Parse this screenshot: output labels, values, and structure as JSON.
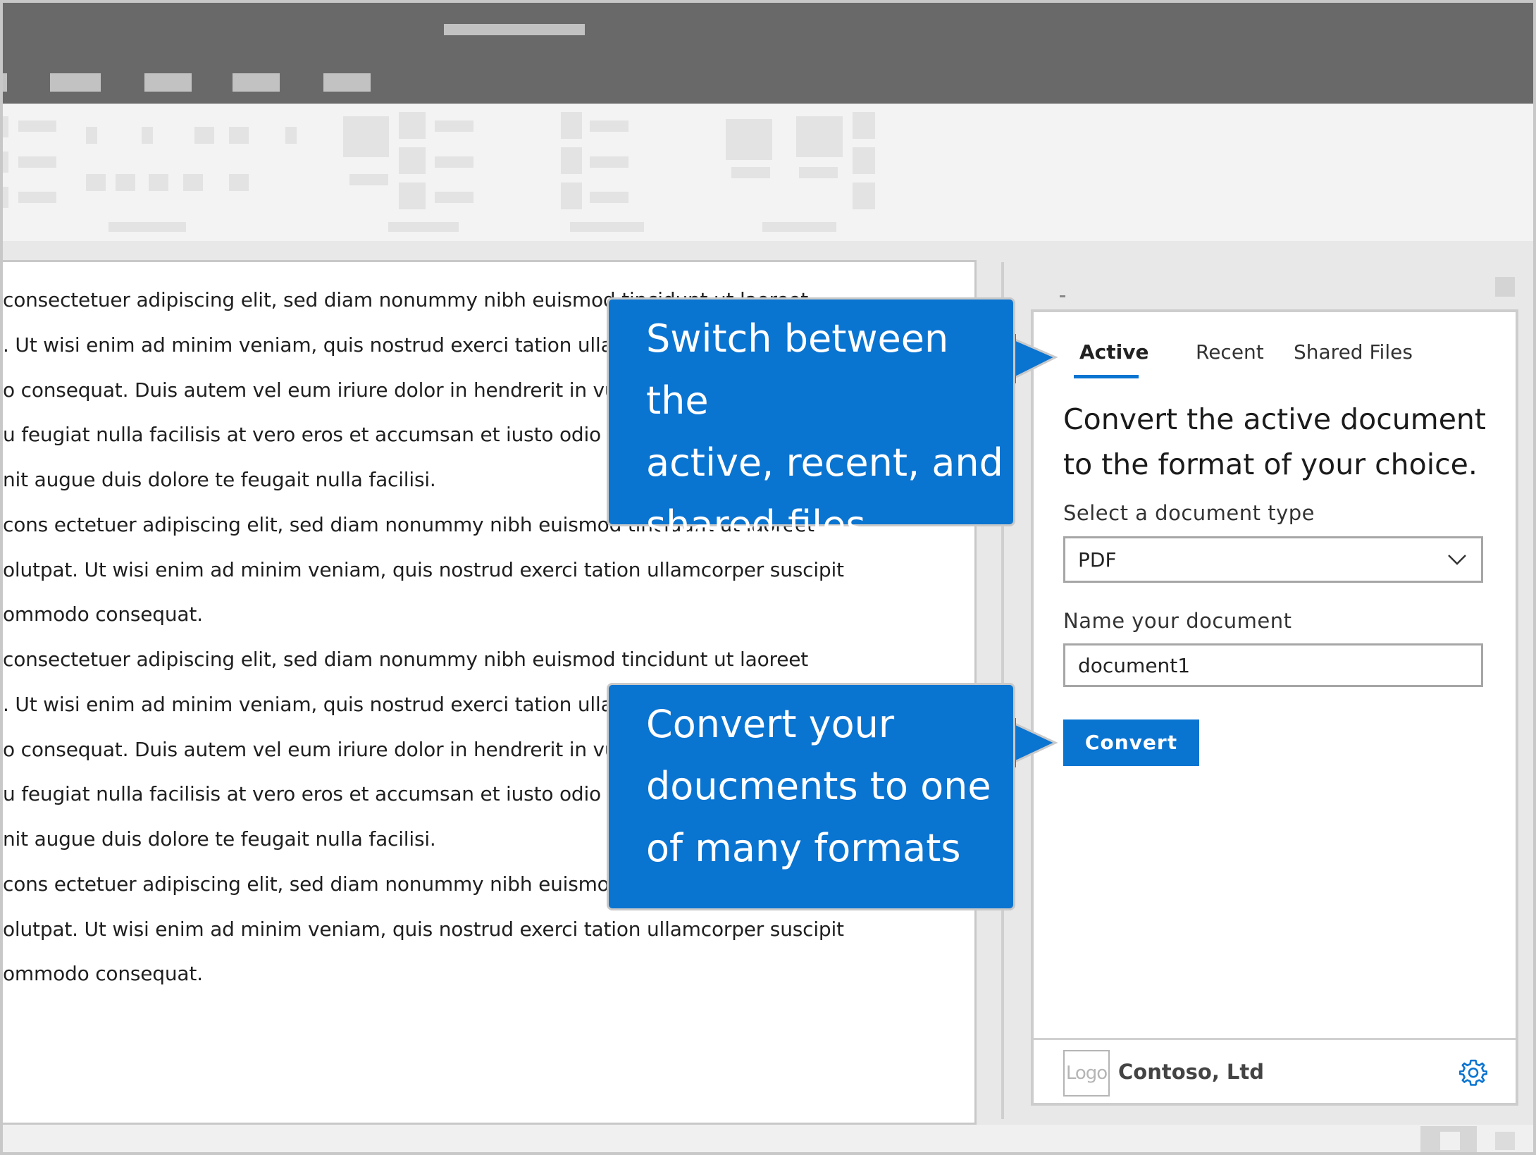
{
  "document": {
    "lines": [
      "consectetuer adipiscing elit, sed diam nonummy nibh euismod tincidunt ut laoreet",
      ". Ut wisi enim ad minim veniam, quis nostrud exerci tation ullamcorper suscipit",
      "o consequat. Duis autem vel eum iriure dolor in hendrerit in vulputate velit esse",
      "u feugiat nulla facilisis at vero eros et accumsan et iusto odio dignissim qui blandit",
      "nit augue duis dolore te feugait nulla facilisi.",
      "cons ectetuer adipiscing elit, sed diam nonummy nibh euismod tincidunt ut laoreet",
      "olutpat. Ut wisi enim ad minim veniam, quis nostrud exerci tation ullamcorper suscipit",
      "ommodo consequat.",
      "consectetuer adipiscing elit, sed diam nonummy nibh euismod tincidunt ut laoreet",
      ". Ut wisi enim ad minim veniam, quis nostrud exerci tation ullamcorper suscipit",
      "o consequat. Duis autem vel eum iriure dolor in hendrerit in vulputate velit esse",
      "u feugiat nulla facilisis at vero eros et accumsan et iusto odio dignissim qui blandit",
      "nit augue duis dolore te feugait nulla facilisi.",
      "cons ectetuer adipiscing elit, sed diam nonummy nibh euismod tincidunt ut laoreet",
      "olutpat. Ut wisi enim ad minim veniam, quis nostrud exerci tation ullamcorper suscipit",
      "ommodo consequat."
    ]
  },
  "pane": {
    "tabs": [
      {
        "label": "Active",
        "active": true
      },
      {
        "label": "Recent",
        "active": false
      },
      {
        "label": "Shared Files",
        "active": false
      }
    ],
    "heading": "Convert the active document to the format of your choice.",
    "doc_type_label": "Select a document type",
    "doc_type_value": "PDF",
    "name_label": "Name your document",
    "name_value": "document1",
    "convert_label": "Convert",
    "footer": {
      "logo_text": "Logo",
      "company": "Contoso, Ltd",
      "settings_icon": "gear-icon"
    }
  },
  "callouts": {
    "tabs_hint": [
      "Switch between the",
      "active, recent, and",
      "shared files."
    ],
    "convert_hint": [
      "Convert your",
      "doucments to one",
      "of many formats"
    ]
  },
  "colors": {
    "accent": "#0a74d1",
    "titlebar": "#696969",
    "ribbon": "#f3f3f3"
  }
}
